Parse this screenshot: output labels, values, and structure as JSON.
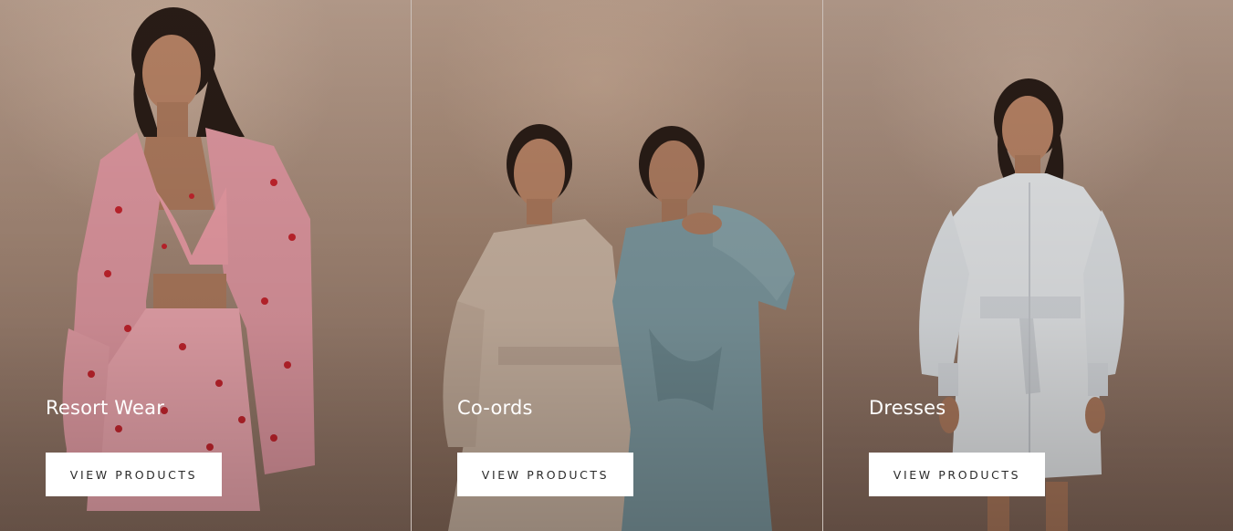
{
  "collections": [
    {
      "title": "Resort Wear",
      "button_label": "VIEW PRODUCTS",
      "image_icon": "model-in-pink-heart-print-set"
    },
    {
      "title": "Co-ords",
      "button_label": "VIEW PRODUCTS",
      "image_icon": "two-models-in-satin-coords"
    },
    {
      "title": "Dresses",
      "button_label": "VIEW PRODUCTS",
      "image_icon": "model-in-white-shirt-dress"
    }
  ],
  "colors": {
    "button_background": "#ffffff",
    "button_text": "#2b2b2b",
    "title_text": "#ffffff",
    "panel_divider": "#ffffff"
  }
}
